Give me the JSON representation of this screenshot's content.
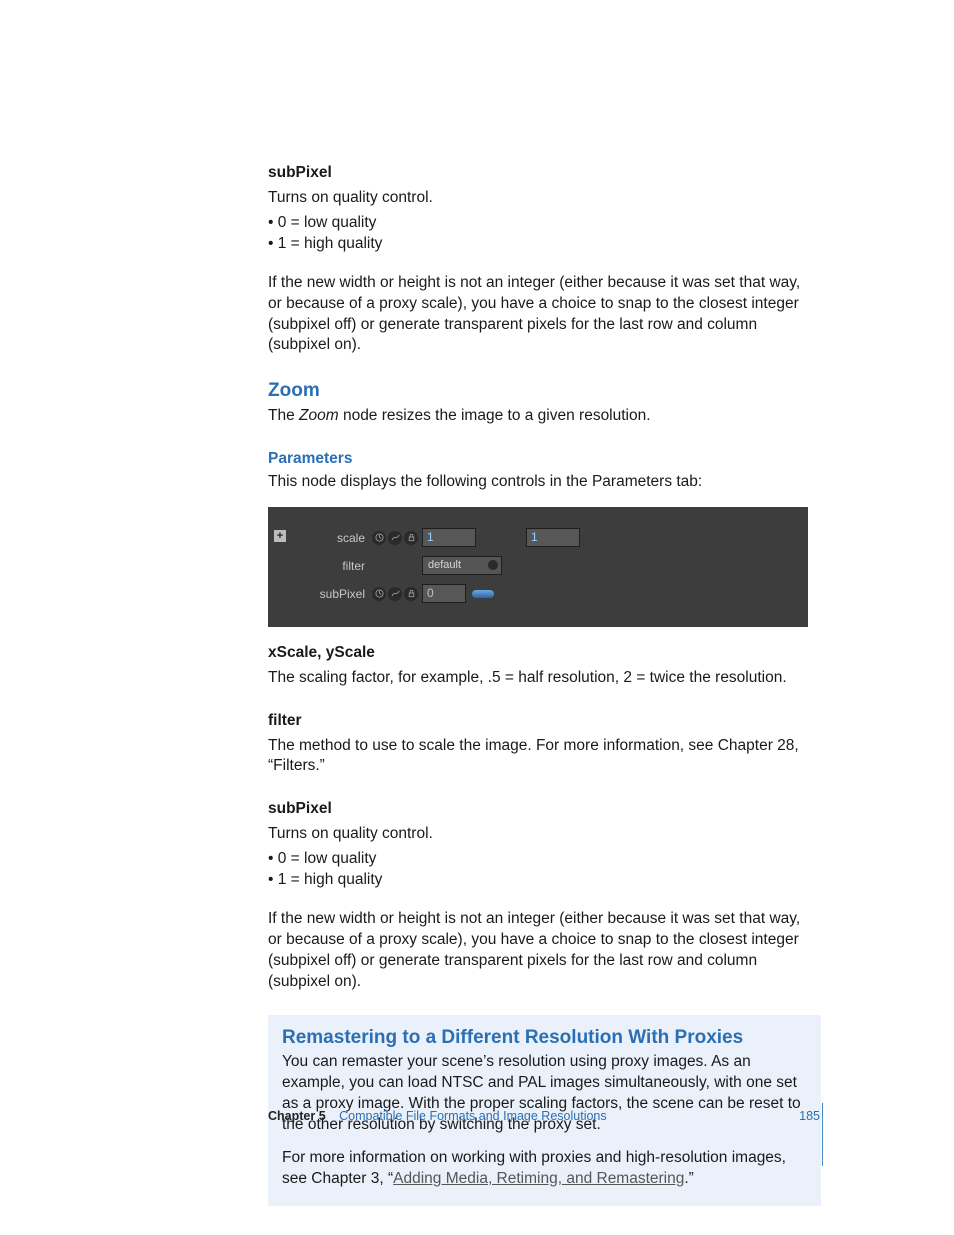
{
  "top": {
    "subpixel_label": "subPixel",
    "subpixel_desc": "Turns on quality control.",
    "bullet0": "0 = low quality",
    "bullet1": "1 = high quality",
    "subpixel_explain": "If the new width or height is not an integer (either because it was set that way, or because of a proxy scale), you have a choice to snap to the closest integer (subpixel off) or generate transparent pixels for the last row and column (subpixel on)."
  },
  "zoom": {
    "heading": "Zoom",
    "intro_pre": "The ",
    "intro_em": "Zoom",
    "intro_post": " node resizes the image to a given resolution.",
    "params_heading": "Parameters",
    "params_desc": "This node displays the following controls in the Parameters tab:"
  },
  "panel": {
    "expand": "+",
    "scale_label": "scale",
    "scale_val1": "1",
    "scale_val2": "1",
    "filter_label": "filter",
    "filter_val": "default",
    "subpixel_label": "subPixel",
    "subpixel_val": "0"
  },
  "zoom_params": {
    "xyscale_label": "xScale, yScale",
    "xyscale_desc": "The scaling factor, for example, .5 = half resolution, 2 = twice the resolution.",
    "filter_label": "filter",
    "filter_desc": "The method to use to scale the image. For more information, see Chapter 28, “Filters.”",
    "subpixel_label": "subPixel",
    "subpixel_desc": "Turns on quality control.",
    "bullet0": "0 = low quality",
    "bullet1": "1 = high quality",
    "subpixel_explain": "If the new width or height is not an integer (either because it was set that way, or because of a proxy scale), you have a choice to snap to the closest integer (subpixel off) or generate transparent pixels for the last row and column (subpixel on)."
  },
  "remaster": {
    "heading": "Remastering to a Different Resolution With Proxies",
    "p1": "You can remaster your scene’s resolution using proxy images. As an example, you can load NTSC and PAL images simultaneously, with one set as a proxy image. With the proper scaling factors, the scene can be reset to the other resolution by switching the proxy set.",
    "p2_pre": "For more information on working with proxies and high-resolution images, see Chapter 3, “",
    "p2_link": "Adding Media, Retiming, and Remastering",
    "p2_post": ".”"
  },
  "footer": {
    "chapter_label": "Chapter 5",
    "chapter_title": "Compatible File Formats and Image Resolutions",
    "page": "185"
  }
}
